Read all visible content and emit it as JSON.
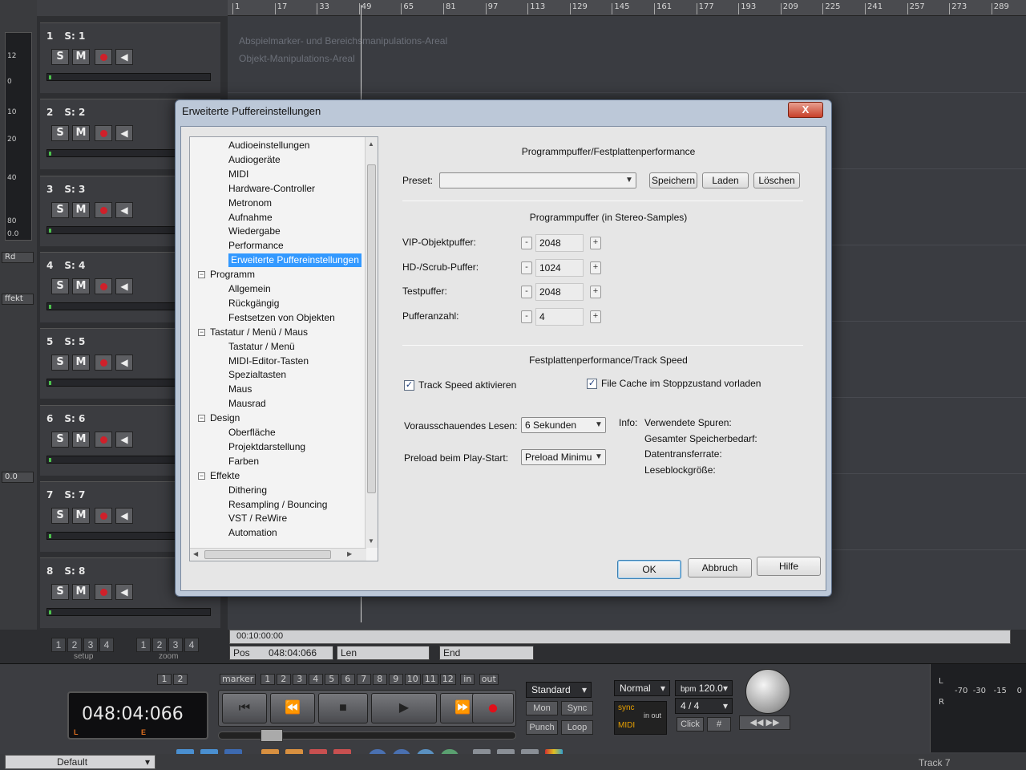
{
  "ruler": [
    "1",
    "17",
    "33",
    "49",
    "65",
    "81",
    "97",
    "113",
    "129",
    "145",
    "161",
    "177",
    "193",
    "209",
    "225",
    "241",
    "257",
    "273",
    "289"
  ],
  "meter_labels": [
    "12",
    "0",
    "10",
    "20",
    "40",
    "80",
    "0.0"
  ],
  "left_ctrls": {
    "rd": "Rd",
    "effekt": "ffekt",
    "level": "0.0"
  },
  "tracks": [
    {
      "num": "1",
      "name": "S: 1"
    },
    {
      "num": "2",
      "name": "S: 2"
    },
    {
      "num": "3",
      "name": "S: 3"
    },
    {
      "num": "4",
      "name": "S: 4"
    },
    {
      "num": "5",
      "name": "S: 5"
    },
    {
      "num": "6",
      "name": "S: 6"
    },
    {
      "num": "7",
      "name": "S: 7"
    },
    {
      "num": "8",
      "name": "S: 8"
    }
  ],
  "track_btn": {
    "solo": "S",
    "mute": "M"
  },
  "arrange": {
    "area1": "Abspielmarker- und Bereichsmanipulations-Areal",
    "area2": "Objekt-Manipulations-Areal"
  },
  "bottom": {
    "timecode": "00:10:00:00",
    "pos_label": "Pos",
    "pos_value": "048:04:066",
    "len_label": "Len",
    "end_label": "End",
    "setup_nums": [
      "1",
      "2",
      "3",
      "4"
    ],
    "setup_caption": "setup",
    "zoom_nums": [
      "1",
      "2",
      "3",
      "4"
    ],
    "zoom_caption": "zoom"
  },
  "transport": {
    "marker_label": "marker",
    "marker_nums": [
      "1",
      "2",
      "3",
      "4",
      "5",
      "6",
      "7",
      "8",
      "9",
      "10",
      "11",
      "12"
    ],
    "in_label": "in",
    "out_label": "out",
    "left_nums": [
      "1",
      "2"
    ],
    "clock": "048:04:066",
    "clock_l": "L",
    "clock_e": "E",
    "mode": "Standard",
    "mon": "Mon",
    "sync": "Sync",
    "punch": "Punch",
    "loop": "Loop",
    "normal": "Normal",
    "bpm_label": "bpm",
    "bpm": "120.0",
    "signature": "4 / 4",
    "sync_tag": "sync",
    "midi_tag": "MIDI",
    "inout": "in out",
    "click": "Click",
    "meter_l": "L",
    "meter_r": "R",
    "meter_scale": "-70  -30   -15    0"
  },
  "status": {
    "preset": "Default",
    "track": "Track 7"
  },
  "dialog": {
    "title": "Erweiterte Puffereinstellungen",
    "close": "X",
    "tree": [
      {
        "label": "Audioeinstellungen",
        "level": 2
      },
      {
        "label": "Audiogeräte",
        "level": 2
      },
      {
        "label": "MIDI",
        "level": 2
      },
      {
        "label": "Hardware-Controller",
        "level": 2
      },
      {
        "label": "Metronom",
        "level": 2
      },
      {
        "label": "Aufnahme",
        "level": 2
      },
      {
        "label": "Wiedergabe",
        "level": 2
      },
      {
        "label": "Performance",
        "level": 2
      },
      {
        "label": "Erweiterte Puffereinstellungen",
        "level": 2,
        "selected": true
      },
      {
        "label": "Programm",
        "level": 1
      },
      {
        "label": "Allgemein",
        "level": 2
      },
      {
        "label": "Rückgängig",
        "level": 2
      },
      {
        "label": "Festsetzen von Objekten",
        "level": 2
      },
      {
        "label": "Tastatur / Menü / Maus",
        "level": 1
      },
      {
        "label": "Tastatur / Menü",
        "level": 2
      },
      {
        "label": "MIDI-Editor-Tasten",
        "level": 2
      },
      {
        "label": "Spezialtasten",
        "level": 2
      },
      {
        "label": "Maus",
        "level": 2
      },
      {
        "label": "Mausrad",
        "level": 2
      },
      {
        "label": "Design",
        "level": 1
      },
      {
        "label": "Oberfläche",
        "level": 2
      },
      {
        "label": "Projektdarstellung",
        "level": 2
      },
      {
        "label": "Farben",
        "level": 2
      },
      {
        "label": "Effekte",
        "level": 1
      },
      {
        "label": "Dithering",
        "level": 2
      },
      {
        "label": "Resampling / Bouncing",
        "level": 2
      },
      {
        "label": "VST / ReWire",
        "level": 2
      },
      {
        "label": "Automation",
        "level": 2
      }
    ],
    "header": "Programmpuffer/Festplattenperformance",
    "preset_label": "Preset:",
    "preset_value": "",
    "save": "Speichern",
    "load": "Laden",
    "delete": "Löschen",
    "buffer_title": "Programmpuffer (in Stereo-Samples)",
    "buffers": [
      {
        "label": "VIP-Objektpuffer:",
        "value": "2048"
      },
      {
        "label": "HD-/Scrub-Puffer:",
        "value": "1024"
      },
      {
        "label": "Testpuffer:",
        "value": "2048"
      },
      {
        "label": "Pufferanzahl:",
        "value": "4"
      }
    ],
    "minus": "-",
    "plus": "+",
    "disk_title": "Festplattenperformance/Track Speed",
    "trackspeed": "Track Speed aktivieren",
    "filecache": "File Cache im Stoppzustand vorladen",
    "check_mark": "✓",
    "read_label": "Vorausschauendes Lesen:",
    "read_value": "6 Sekunden",
    "preload_label": "Preload beim Play-Start:",
    "preload_value": "Preload Minimur",
    "info_label": "Info:",
    "info": [
      "Verwendete Spuren:",
      "Gesamter Speicherbedarf:",
      "Datentransferrate:",
      "Leseblockgröße:"
    ],
    "ok": "OK",
    "cancel": "Abbruch",
    "help": "Hilfe"
  }
}
